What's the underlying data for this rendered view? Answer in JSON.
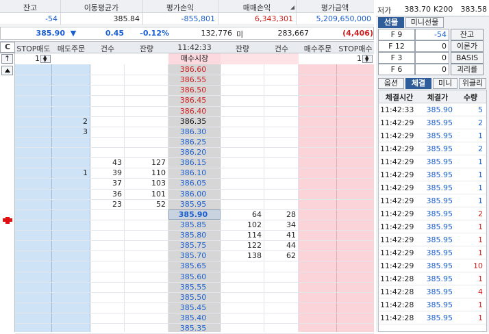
{
  "summary": {
    "headers": [
      "잔고",
      "이동평균가",
      "평가손익",
      "매매손익",
      "평가금액"
    ],
    "values": [
      "-54",
      "385.84",
      "-855,801",
      "6,343,301",
      "5,209,650,000"
    ]
  },
  "quote": {
    "price": "385.90",
    "direction": "▼",
    "change": "0.45",
    "change_pct": "-0.12%",
    "volume": "132,776",
    "unfilled_label": "미",
    "open_interest": "283,667",
    "oi_change": "(4,406)"
  },
  "ladder": {
    "headers": [
      "C",
      "STOP매도",
      "매도주문",
      "건수",
      "잔량",
      "11:42:33",
      "잔량",
      "건수",
      "매수주문",
      "STOP매수"
    ],
    "stop_sell_qty": "1",
    "stop_buy_qty": "1",
    "up_arrow": "↑",
    "market_buy_label": "매수시장",
    "current_price": "385.90",
    "rows": [
      {
        "price": "386.60",
        "ask_cnt": "",
        "ask_qty": "",
        "sell_order": "",
        "bid_qty": "",
        "bid_cnt": "",
        "pcolor": "red"
      },
      {
        "price": "386.55",
        "ask_cnt": "",
        "ask_qty": "",
        "sell_order": "",
        "bid_qty": "",
        "bid_cnt": "",
        "pcolor": "red"
      },
      {
        "price": "386.50",
        "ask_cnt": "",
        "ask_qty": "",
        "sell_order": "",
        "bid_qty": "",
        "bid_cnt": "",
        "pcolor": "red"
      },
      {
        "price": "386.45",
        "ask_cnt": "",
        "ask_qty": "",
        "sell_order": "",
        "bid_qty": "",
        "bid_cnt": "",
        "pcolor": "red"
      },
      {
        "price": "386.40",
        "ask_cnt": "",
        "ask_qty": "",
        "sell_order": "",
        "bid_qty": "",
        "bid_cnt": "",
        "pcolor": "red"
      },
      {
        "price": "386.35",
        "ask_cnt": "",
        "ask_qty": "",
        "sell_order": "2",
        "bid_qty": "",
        "bid_cnt": "",
        "pcolor": "black"
      },
      {
        "price": "386.30",
        "ask_cnt": "",
        "ask_qty": "",
        "sell_order": "3",
        "bid_qty": "",
        "bid_cnt": "",
        "pcolor": "blue"
      },
      {
        "price": "386.25",
        "ask_cnt": "",
        "ask_qty": "",
        "sell_order": "",
        "bid_qty": "",
        "bid_cnt": "",
        "pcolor": "blue"
      },
      {
        "price": "386.20",
        "ask_cnt": "",
        "ask_qty": "",
        "sell_order": "",
        "bid_qty": "",
        "bid_cnt": "",
        "pcolor": "blue"
      },
      {
        "price": "386.15",
        "ask_cnt": "43",
        "ask_qty": "127",
        "sell_order": "",
        "bid_qty": "",
        "bid_cnt": "",
        "pcolor": "blue"
      },
      {
        "price": "386.10",
        "ask_cnt": "39",
        "ask_qty": "110",
        "sell_order": "1",
        "bid_qty": "",
        "bid_cnt": "",
        "pcolor": "blue"
      },
      {
        "price": "386.05",
        "ask_cnt": "37",
        "ask_qty": "103",
        "sell_order": "",
        "bid_qty": "",
        "bid_cnt": "",
        "pcolor": "blue"
      },
      {
        "price": "386.00",
        "ask_cnt": "36",
        "ask_qty": "101",
        "sell_order": "",
        "bid_qty": "",
        "bid_cnt": "",
        "pcolor": "blue"
      },
      {
        "price": "385.95",
        "ask_cnt": "23",
        "ask_qty": "52",
        "sell_order": "",
        "bid_qty": "",
        "bid_cnt": "",
        "pcolor": "blue"
      },
      {
        "price": "385.90",
        "ask_cnt": "",
        "ask_qty": "",
        "sell_order": "",
        "bid_qty": "64",
        "bid_cnt": "28",
        "pcolor": "blue"
      },
      {
        "price": "385.85",
        "ask_cnt": "",
        "ask_qty": "",
        "sell_order": "",
        "bid_qty": "102",
        "bid_cnt": "34",
        "pcolor": "blue"
      },
      {
        "price": "385.80",
        "ask_cnt": "",
        "ask_qty": "",
        "sell_order": "",
        "bid_qty": "114",
        "bid_cnt": "41",
        "pcolor": "blue"
      },
      {
        "price": "385.75",
        "ask_cnt": "",
        "ask_qty": "",
        "sell_order": "",
        "bid_qty": "122",
        "bid_cnt": "44",
        "pcolor": "blue"
      },
      {
        "price": "385.70",
        "ask_cnt": "",
        "ask_qty": "",
        "sell_order": "",
        "bid_qty": "138",
        "bid_cnt": "62",
        "pcolor": "blue"
      },
      {
        "price": "385.65",
        "ask_cnt": "",
        "ask_qty": "",
        "sell_order": "",
        "bid_qty": "",
        "bid_cnt": "",
        "pcolor": "blue"
      },
      {
        "price": "385.60",
        "ask_cnt": "",
        "ask_qty": "",
        "sell_order": "",
        "bid_qty": "",
        "bid_cnt": "",
        "pcolor": "blue"
      },
      {
        "price": "385.55",
        "ask_cnt": "",
        "ask_qty": "",
        "sell_order": "",
        "bid_qty": "",
        "bid_cnt": "",
        "pcolor": "blue"
      },
      {
        "price": "385.50",
        "ask_cnt": "",
        "ask_qty": "",
        "sell_order": "",
        "bid_qty": "",
        "bid_cnt": "",
        "pcolor": "blue"
      },
      {
        "price": "385.45",
        "ask_cnt": "",
        "ask_qty": "",
        "sell_order": "",
        "bid_qty": "",
        "bid_cnt": "",
        "pcolor": "blue"
      },
      {
        "price": "385.40",
        "ask_cnt": "",
        "ask_qty": "",
        "sell_order": "",
        "bid_qty": "",
        "bid_cnt": "",
        "pcolor": "blue"
      },
      {
        "price": "385.35",
        "ask_cnt": "",
        "ask_qty": "",
        "sell_order": "",
        "bid_qty": "",
        "bid_cnt": "",
        "pcolor": "blue"
      }
    ]
  },
  "right_panel": {
    "top_info": {
      "label1": "저가",
      "value1": "383.70",
      "label2": "K200",
      "value2": "383.58"
    },
    "tabs_top": [
      "선물",
      "미니선물"
    ],
    "fkeys": [
      {
        "key": "F 9",
        "value": "-54",
        "button": "잔고"
      },
      {
        "key": "F 12",
        "value": "0",
        "button": "이론가"
      },
      {
        "key": "F 3",
        "value": "0",
        "button": "BASIS"
      },
      {
        "key": "F 6",
        "value": "0",
        "button": "괴리률"
      }
    ],
    "tabs_bottom": [
      "옵션",
      "체결",
      "미니",
      "위클리"
    ],
    "trade_headers": [
      "체결시간",
      "체결가",
      "수량"
    ],
    "trades": [
      {
        "time": "11:42:33",
        "price": "385.90",
        "qty": "5",
        "qcolor": "blue"
      },
      {
        "time": "11:42:29",
        "price": "385.95",
        "qty": "2",
        "qcolor": "blue"
      },
      {
        "time": "11:42:29",
        "price": "385.95",
        "qty": "1",
        "qcolor": "blue"
      },
      {
        "time": "11:42:29",
        "price": "385.95",
        "qty": "2",
        "qcolor": "blue"
      },
      {
        "time": "11:42:29",
        "price": "385.95",
        "qty": "1",
        "qcolor": "blue"
      },
      {
        "time": "11:42:29",
        "price": "385.95",
        "qty": "1",
        "qcolor": "blue"
      },
      {
        "time": "11:42:29",
        "price": "385.95",
        "qty": "1",
        "qcolor": "blue"
      },
      {
        "time": "11:42:29",
        "price": "385.95",
        "qty": "1",
        "qcolor": "blue"
      },
      {
        "time": "11:42:29",
        "price": "385.95",
        "qty": "2",
        "qcolor": "red"
      },
      {
        "time": "11:42:29",
        "price": "385.95",
        "qty": "1",
        "qcolor": "red"
      },
      {
        "time": "11:42:29",
        "price": "385.95",
        "qty": "1",
        "qcolor": "red"
      },
      {
        "time": "11:42:29",
        "price": "385.95",
        "qty": "1",
        "qcolor": "red"
      },
      {
        "time": "11:42:29",
        "price": "385.95",
        "qty": "10",
        "qcolor": "red"
      },
      {
        "time": "11:42:28",
        "price": "385.95",
        "qty": "1",
        "qcolor": "red"
      },
      {
        "time": "11:42:28",
        "price": "385.95",
        "qty": "4",
        "qcolor": "red"
      },
      {
        "time": "11:42:28",
        "price": "385.95",
        "qty": "1",
        "qcolor": "red"
      },
      {
        "time": "11:42:28",
        "price": "385.95",
        "qty": "1",
        "qcolor": "red"
      }
    ]
  },
  "colors": {
    "ask_bg": "#cfe3f6",
    "bid_bg": "#fad4d8",
    "price_bg": "#d6d6d6",
    "current_bg": "#c9d3e0",
    "market_row_bg": "#fde3e6"
  }
}
